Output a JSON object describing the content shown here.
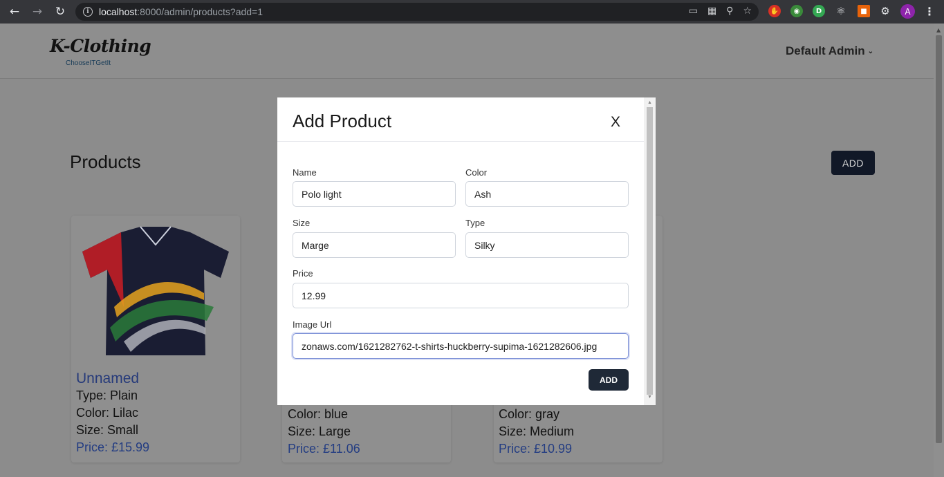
{
  "browser": {
    "url_host": "localhost",
    "url_rest": ":8000/admin/products?add=1",
    "profile_initial": "A"
  },
  "header": {
    "logo_text": "K-Clothing",
    "logo_tagline": "ChooseITGetIt",
    "user_name": "Default Admin"
  },
  "page": {
    "title": "Products",
    "add_label": "ADD"
  },
  "products": [
    {
      "name": "Unnamed",
      "type": "Type: Plain",
      "color": "Color: Lilac",
      "size": "Size: Small",
      "price": "Price: £15.99"
    },
    {
      "color": "Color: blue",
      "size": "Size: Large",
      "price": "Price: £11.06"
    },
    {
      "color": "Color: gray",
      "size": "Size: Medium",
      "price": "Price: £10.99"
    }
  ],
  "modal": {
    "title": "Add Product",
    "close_label": "X",
    "fields": {
      "name": {
        "label": "Name",
        "value": "Polo light"
      },
      "color": {
        "label": "Color",
        "value": "Ash"
      },
      "size": {
        "label": "Size",
        "value": "Marge"
      },
      "type": {
        "label": "Type",
        "value": "Silky"
      },
      "price": {
        "label": "Price",
        "value": "12.99"
      },
      "image_url": {
        "label": "Image Url",
        "value": "zonaws.com/1621282762-t-shirts-huckberry-supima-1621282606.jpg"
      }
    },
    "submit_label": "ADD"
  },
  "colors": {
    "accent_dark": "#1f2937",
    "link_blue": "#263a7a",
    "overlay": "#8c8c8c"
  }
}
